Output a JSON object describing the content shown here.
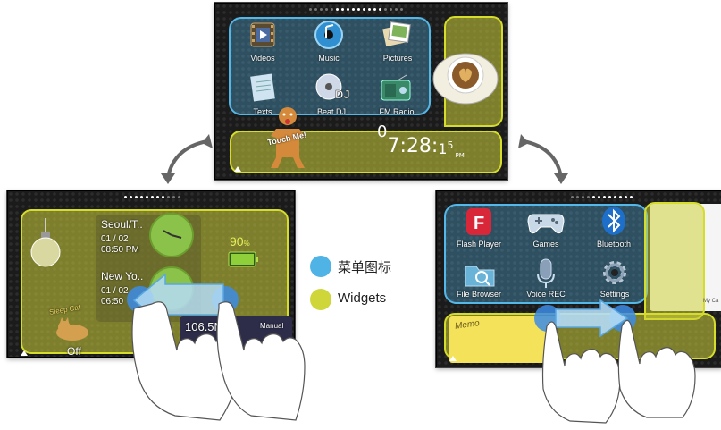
{
  "legend": {
    "menu_label": "菜单图标",
    "menu_color": "#4fb3e6",
    "widget_label": "Widgets",
    "widget_color": "#cfd63a"
  },
  "top_screen": {
    "apps": [
      {
        "label": "Videos",
        "icon": "film-icon"
      },
      {
        "label": "Music",
        "icon": "music-cd-icon"
      },
      {
        "label": "Pictures",
        "icon": "photos-icon"
      },
      {
        "label": "Texts",
        "icon": "notepad-icon"
      },
      {
        "label": "Beat DJ",
        "icon": "dj-disc-icon"
      },
      {
        "label": "FM Radio",
        "icon": "radio-icon"
      }
    ],
    "touch_me": "Touch Me!",
    "clock": {
      "h1": "0",
      "h2": "7",
      "sep": ":",
      "m": "28",
      "colon": ":",
      "s1": "1",
      "s2": "5",
      "ampm": "PM"
    }
  },
  "left_screen": {
    "city1": "Seoul/T..",
    "date1": "01 / 02",
    "time1": "08:50 PM",
    "city2": "New Yo..",
    "date2": "01 / 02",
    "time2": "06:50",
    "battery_value": "90",
    "battery_unit": "%",
    "radio_freq": "106.5MHz",
    "radio_mode": "Manual",
    "sleep_label": "Sleep Cat",
    "off_label": "Off"
  },
  "right_screen": {
    "apps": [
      {
        "label": "Flash Player",
        "icon": "flash-icon"
      },
      {
        "label": "Games",
        "icon": "gamepad-icon"
      },
      {
        "label": "Bluetooth",
        "icon": "bluetooth-icon"
      },
      {
        "label": "File Browser",
        "icon": "folder-search-icon"
      },
      {
        "label": "Voice REC",
        "icon": "microphone-icon"
      },
      {
        "label": "Settings",
        "icon": "gear-icon"
      }
    ],
    "memo_label": "Memo",
    "partial_label": "My Ca"
  }
}
